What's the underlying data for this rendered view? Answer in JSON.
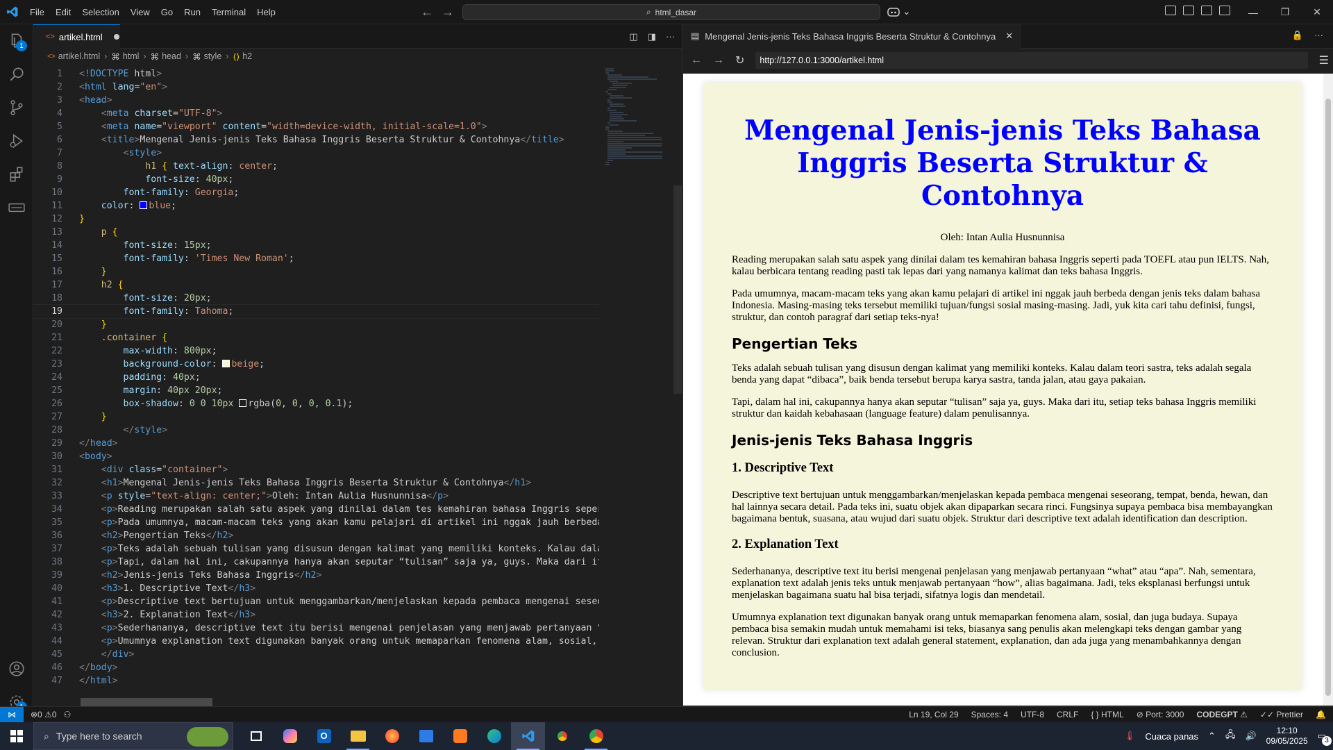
{
  "titlebar": {
    "menu": [
      "File",
      "Edit",
      "Selection",
      "View",
      "Go",
      "Run",
      "Terminal",
      "Help"
    ],
    "search_text": "html_dasar"
  },
  "activity": {
    "explorer_badge": "1",
    "settings_badge": "1"
  },
  "editor": {
    "tab_label": "artikel.html",
    "breadcrumb": [
      "artikel.html",
      "html",
      "head",
      "style",
      "h2"
    ]
  },
  "code_lines": [
    "<!DOCTYPE html>",
    "<html lang=\"en\">",
    "<head>",
    "    <meta charset=\"UTF-8\">",
    "    <meta name=\"viewport\" content=\"width=device-width, initial-scale=1.0\">",
    "    <title>Mengenal Jenis-jenis Teks Bahasa Inggris Beserta Struktur & Contohnya</title>",
    "        <style>",
    "            h1 { text-align: center;",
    "            font-size: 40px;",
    "        font-family: Georgia;",
    "    color: blue;",
    "}",
    "    p {",
    "        font-size: 15px;",
    "        font-family: 'Times New Roman';",
    "    }",
    "    h2 {",
    "        font-size: 20px;",
    "        font-family: Tahoma;",
    "    }",
    "    .container {",
    "        max-width: 800px;",
    "        background-color: beige;",
    "        padding: 40px;",
    "        margin: 40px 20px;",
    "        box-shadow: 0 0 10px rgba(0, 0, 0, 0.1);",
    "    }",
    "        </style>",
    "</head>",
    "<body>",
    "    <div class=\"container\">",
    "    <h1>Mengenal Jenis-jenis Teks Bahasa Inggris Beserta Struktur & Contohnya</h1>",
    "    <p style=\"text-align: center;\">Oleh: Intan Aulia Husnunnisa</p>",
    "    <p>Reading merupakan salah satu aspek yang dinilai dalam tes kemahiran bahasa Inggris seperti",
    "    <p>Pada umumnya, macam-macam teks yang akan kamu pelajari di artikel ini nggak jauh berbeda de",
    "    <h2>Pengertian Teks</h2>",
    "    <p>Teks adalah sebuah tulisan yang disusun dengan kalimat yang memiliki konteks. Kalau dalam t",
    "    <p>Tapi, dalam hal ini, cakupannya hanya akan seputar “tulisan” saja ya, guys. Maka dari itu,",
    "    <h2>Jenis-jenis Teks Bahasa Inggris</h2>",
    "    <h3>1. Descriptive Text</h3>",
    "    <p>Descriptive text bertujuan untuk menggambarkan/menjelaskan kepada pembaca mengenai seseorar",
    "    <h3>2. Explanation Text</h3>",
    "    <p>Sederhananya, descriptive text itu berisi mengenai penjelasan yang menjawab pertanyaan “wha",
    "    <p>Umumnya explanation text digunakan banyak orang untuk memaparkan fenomena alam, sosial, dar",
    "    </div>",
    "</body>",
    "</html>"
  ],
  "preview": {
    "tab_title": "Mengenal Jenis-jenis Teks Bahasa Inggris Beserta Struktur & Contohnya",
    "url": "http://127.0.0.1:3000/artikel.html",
    "h1": "Mengenal Jenis-jenis Teks Bahasa Inggris Beserta Struktur & Contohnya",
    "author": "Oleh: Intan Aulia Husnunnisa",
    "p1": "Reading merupakan salah satu aspek yang dinilai dalam tes kemahiran bahasa Inggris seperti pada TOEFL atau pun IELTS. Nah, kalau berbicara tentang reading pasti tak lepas dari yang namanya kalimat dan teks bahasa Inggris.",
    "p2": "Pada umumnya, macam-macam teks yang akan kamu pelajari di artikel ini nggak jauh berbeda dengan jenis teks dalam bahasa Indonesia. Masing-masing teks tersebut memiliki tujuan/fungsi sosial masing-masing. Jadi, yuk kita cari tahu definisi, fungsi, struktur, dan contoh paragraf dari setiap teks-nya!",
    "h2_1": "Pengertian Teks",
    "p3": "Teks adalah sebuah tulisan yang disusun dengan kalimat yang memiliki konteks. Kalau dalam teori sastra, teks adalah segala benda yang dapat “dibaca”, baik benda tersebut berupa karya sastra, tanda jalan, atau gaya pakaian.",
    "p4": "Tapi, dalam hal ini, cakupannya hanya akan seputar “tulisan” saja ya, guys. Maka dari itu, setiap teks bahasa Inggris memiliki struktur dan kaidah kebahasaan (language feature) dalam penulisannya.",
    "h2_2": "Jenis-jenis Teks Bahasa Inggris",
    "h3_1": "1. Descriptive Text",
    "p5": "Descriptive text bertujuan untuk menggambarkan/menjelaskan kepada pembaca mengenai seseorang, tempat, benda, hewan, dan hal lainnya secara detail. Pada teks ini, suatu objek akan dipaparkan secara rinci. Fungsinya supaya pembaca bisa membayangkan bagaimana bentuk, suasana, atau wujud dari suatu objek. Struktur dari descriptive text adalah identification dan description.",
    "h3_2": "2. Explanation Text",
    "p6": "Sederhananya, descriptive text itu berisi mengenai penjelasan yang menjawab pertanyaan “what” atau “apa”. Nah, sementara, explanation text adalah jenis teks untuk menjawab pertanyaan “how”, alias bagaimana. Jadi, teks eksplanasi berfungsi untuk menjelaskan bagaimana suatu hal bisa terjadi, sifatnya logis dan mendetail.",
    "p7": "Umumnya explanation text digunakan banyak orang untuk memaparkan fenomena alam, sosial, dan juga budaya. Supaya pembaca bisa semakin mudah untuk memahami isi teks, biasanya sang penulis akan melengkapi teks dengan gambar yang relevan. Struktur dari explanation text adalah general statement, explanation, dan ada juga yang menambahkannya dengan conclusion."
  },
  "statusbar": {
    "problems": "⊗0 ⚠0",
    "position": "Ln 19, Col 29",
    "spaces": "Spaces: 4",
    "encoding": "UTF-8",
    "eol": "CRLF",
    "language": "HTML",
    "port": "Port: 3000",
    "codegpt": "CODEGPT",
    "prettier": "Prettier"
  },
  "taskbar": {
    "search_placeholder": "Type here to search",
    "weather": "Cuaca panas",
    "time": "12:10",
    "date": "09/05/2025",
    "notif_count": "3"
  },
  "colors": {
    "accent": "#0078d4",
    "page_heading": "#0000ff",
    "container_bg": "#f5f5dc"
  }
}
